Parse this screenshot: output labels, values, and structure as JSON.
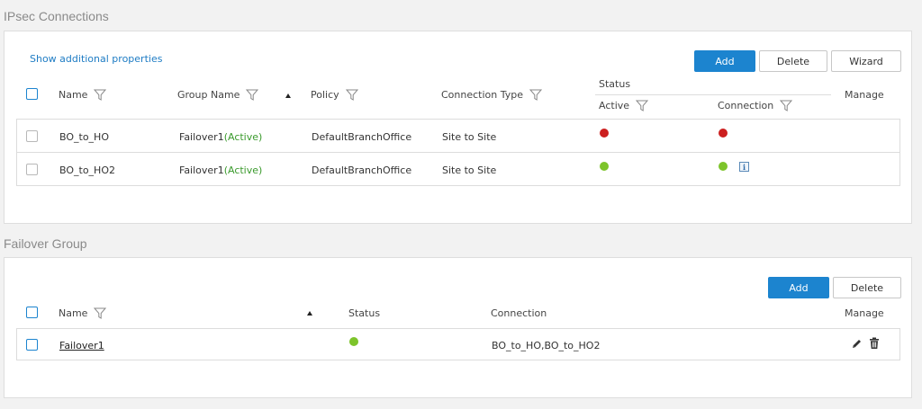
{
  "ipsec": {
    "title": "IPsec Connections",
    "show_props_link": "Show additional properties",
    "buttons": {
      "add": "Add",
      "delete": "Delete",
      "wizard": "Wizard"
    },
    "headers": {
      "name": "Name",
      "group_name": "Group Name",
      "policy": "Policy",
      "connection_type": "Connection Type",
      "status": "Status",
      "active": "Active",
      "connection": "Connection",
      "manage": "Manage"
    },
    "rows": [
      {
        "name": "BO_to_HO",
        "group": "Failover1",
        "group_status": "(Active)",
        "policy": "DefaultBranchOffice",
        "type": "Site to Site",
        "active_color": "#cc1f1f",
        "connection_color": "#cc1f1f"
      },
      {
        "name": "BO_to_HO2",
        "group": "Failover1",
        "group_status": "(Active)",
        "policy": "DefaultBranchOffice",
        "type": "Site to Site",
        "active_color": "#7dc42b",
        "connection_color": "#7dc42b"
      }
    ]
  },
  "failover": {
    "title": "Failover Group",
    "buttons": {
      "add": "Add",
      "delete": "Delete"
    },
    "headers": {
      "name": "Name",
      "status": "Status",
      "connection": "Connection",
      "manage": "Manage"
    },
    "rows": [
      {
        "name": "Failover1",
        "status_color": "#7dc42b",
        "connection": "BO_to_HO,BO_to_HO2"
      }
    ]
  },
  "colors": {
    "accent": "#1c84cf",
    "active_green": "#3a9a2c",
    "down_red": "#cc1f1f",
    "up_green": "#7dc42b"
  }
}
